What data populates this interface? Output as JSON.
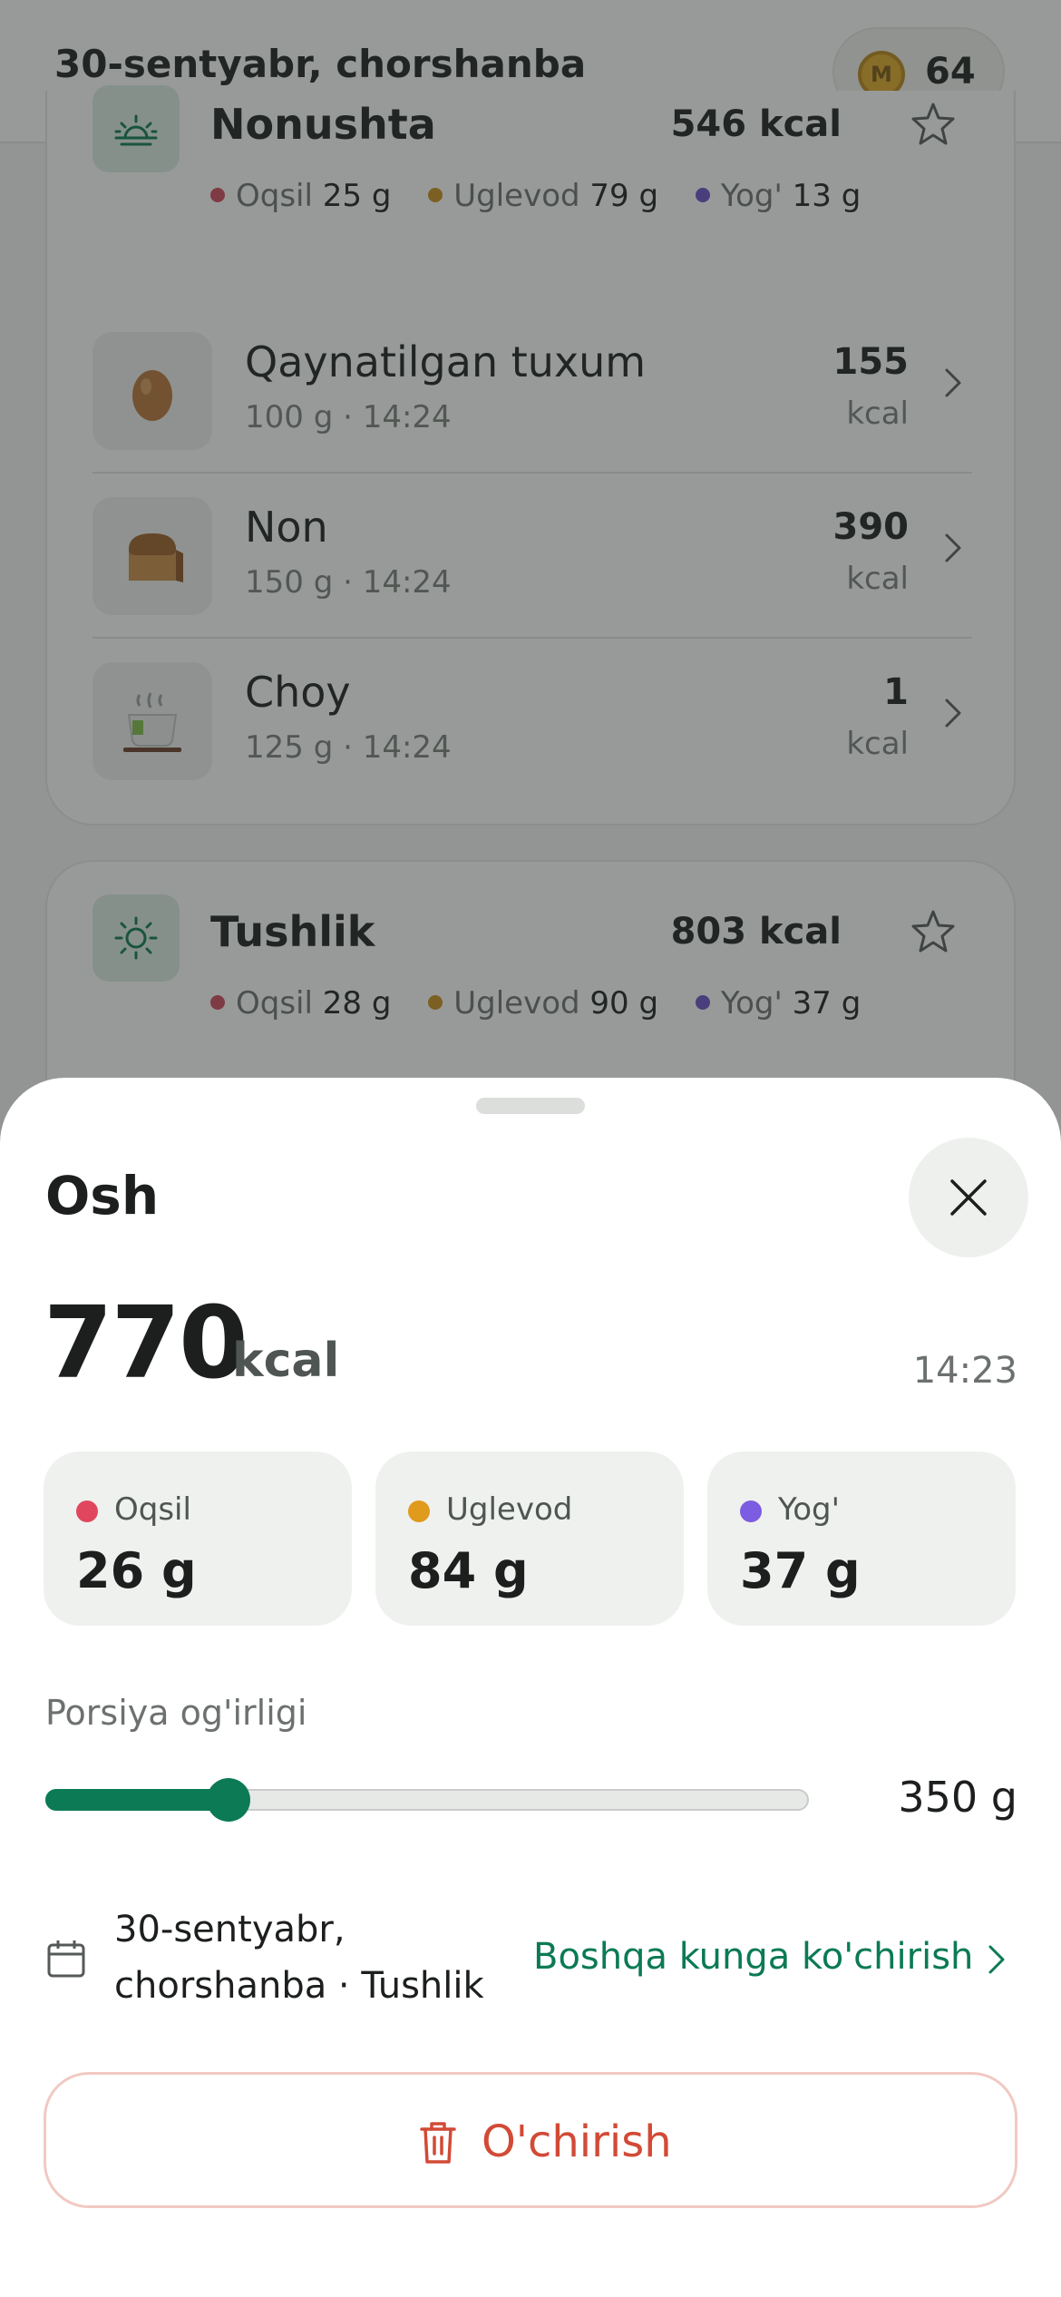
{
  "header": {
    "date": "30-sentyabr, chorshanba",
    "coin_symbol": "M",
    "coins": "64"
  },
  "breakfast": {
    "name": "Nonushta",
    "kcal": "546 kcal",
    "macros": [
      {
        "label": "Oqsil",
        "value": "25 g",
        "color": "#d04a5c"
      },
      {
        "label": "Uglevod",
        "value": "79 g",
        "color": "#c98e1c"
      },
      {
        "label": "Yog'",
        "value": "13 g",
        "color": "#6a50c8"
      }
    ],
    "items": [
      {
        "name": "Qaynatilgan tuxum",
        "meta": "100 g · 14:24",
        "kcal": "155",
        "unit": "kcal",
        "icon": "egg-icon"
      },
      {
        "name": "Non",
        "meta": "150 g · 14:24",
        "kcal": "390",
        "unit": "kcal",
        "icon": "bread-icon"
      },
      {
        "name": "Choy",
        "meta": "125 g · 14:24",
        "kcal": "1",
        "unit": "kcal",
        "icon": "tea-icon"
      }
    ]
  },
  "lunch": {
    "name": "Tushlik",
    "kcal": "803 kcal",
    "macros": [
      {
        "label": "Oqsil",
        "value": "28 g",
        "color": "#d04a5c"
      },
      {
        "label": "Uglevod",
        "value": "90 g",
        "color": "#c98e1c"
      },
      {
        "label": "Yog'",
        "value": "37 g",
        "color": "#6a50c8"
      }
    ]
  },
  "sheet": {
    "title": "Osh",
    "kcal": "770",
    "kcal_unit": "kcal",
    "time": "14:23",
    "macros": [
      {
        "label": "Oqsil",
        "value": "26 g",
        "color": "#e0475e"
      },
      {
        "label": "Uglevod",
        "value": "84 g",
        "color": "#e09a1c"
      },
      {
        "label": "Yog'",
        "value": "37 g",
        "color": "#7c5ce0"
      }
    ],
    "portion_label": "Porsiya og'irligi",
    "portion_value": "350 g",
    "portion_fraction": 0.24,
    "date_line1": "30-sentyabr,",
    "date_line2": "chorshanba · Tushlik",
    "move_label": "Boshqa kunga ko'chirish",
    "delete_label": "O'chirish"
  },
  "colors": {
    "accent": "#0b7a55",
    "danger": "#d24a36"
  }
}
